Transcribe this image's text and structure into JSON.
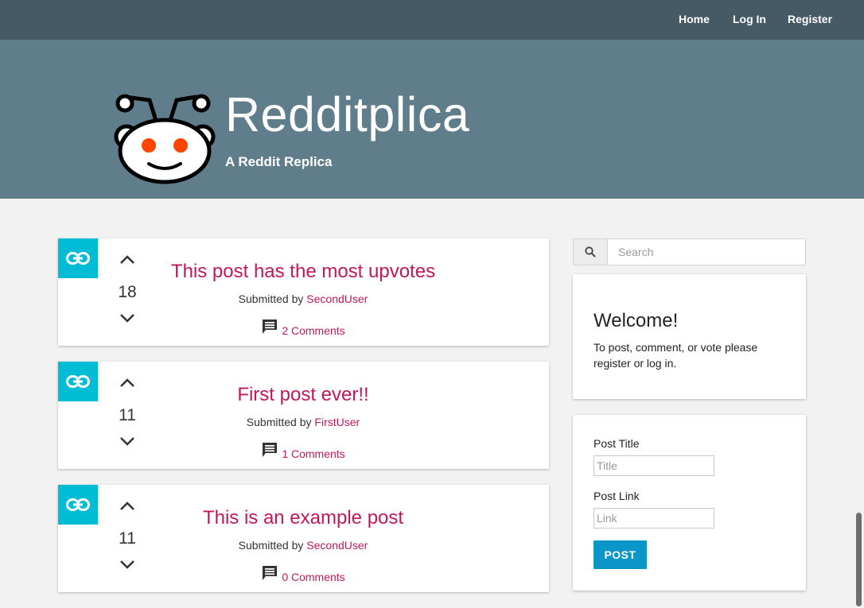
{
  "nav": {
    "home": "Home",
    "login": "Log In",
    "register": "Register"
  },
  "header": {
    "title": "Redditplica",
    "tagline": "A Reddit Replica"
  },
  "posts": [
    {
      "title": "This post has the most upvotes",
      "score": "18",
      "submitted_prefix": "Submitted by ",
      "author": "SecondUser",
      "comments": "2 Comments"
    },
    {
      "title": "First post ever!!",
      "score": "11",
      "submitted_prefix": "Submitted by ",
      "author": "FirstUser",
      "comments": "1 Comments"
    },
    {
      "title": "This is an example post",
      "score": "11",
      "submitted_prefix": "Submitted by ",
      "author": "SecondUser",
      "comments": "0 Comments"
    }
  ],
  "search": {
    "placeholder": "Search"
  },
  "welcome": {
    "title": "Welcome!",
    "text": "To post, comment, or vote please register or log in."
  },
  "post_form": {
    "title_label": "Post Title",
    "title_placeholder": "Title",
    "link_label": "Post Link",
    "link_placeholder": "Link",
    "submit_label": "POST"
  },
  "colors": {
    "nav_bg": "#465a66",
    "hero_bg": "#607d8b",
    "accent_pink": "#c2185b",
    "link_badge": "#00bcd4",
    "button_blue": "#0a96c8",
    "logo_eyes": "#ff4500"
  },
  "icons": {
    "post_link": "link-icon",
    "upvote": "chevron-up-icon",
    "downvote": "chevron-down-icon",
    "comments": "comment-icon",
    "search": "search-icon",
    "logo": "reddit-alien-logo"
  }
}
